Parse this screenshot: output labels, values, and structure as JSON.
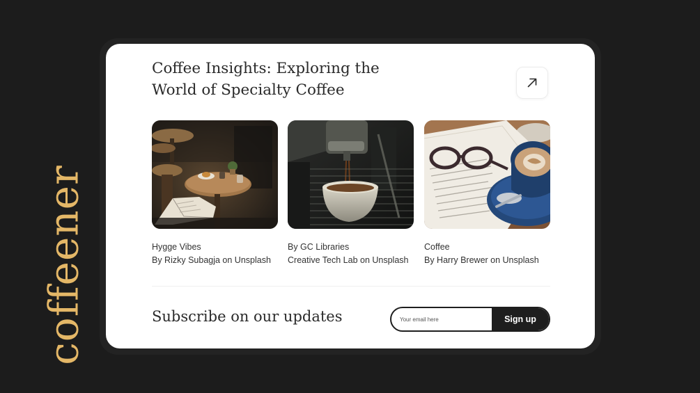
{
  "brand": {
    "name": "coffeener"
  },
  "card": {
    "title_line1": "Coffee Insights: Exploring the",
    "title_line2": "World of Specialty Coffee",
    "open_icon": "arrow-up-right-icon"
  },
  "gallery": [
    {
      "image": "cafe-tables-photo",
      "title": "Hygge Vibes",
      "credit": "By Rizky Subagja on Unsplash"
    },
    {
      "image": "espresso-machine-photo",
      "title": "By GC Libraries",
      "credit": "Creative Tech Lab on Unsplash"
    },
    {
      "image": "coffee-cup-glasses-photo",
      "title": "Coffee",
      "credit": "By Harry Brewer on Unsplash"
    }
  ],
  "subscribe": {
    "title": "Subscribe on our updates",
    "email_placeholder": "Your email here",
    "button_label": "Sign up"
  },
  "colors": {
    "background": "#1c1c1c",
    "card": "#ffffff",
    "brand": "#e4b767",
    "button": "#1e1e1e"
  }
}
